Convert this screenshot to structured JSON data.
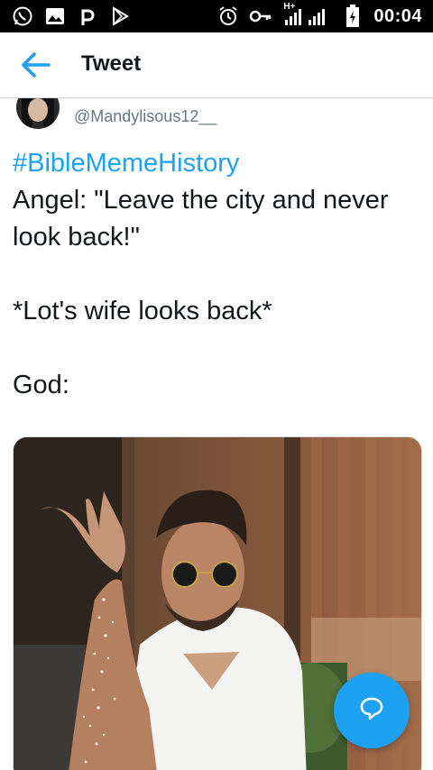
{
  "status_bar": {
    "time": "00:04",
    "network_label": "H+",
    "icons": [
      "whatsapp-icon",
      "gallery-icon",
      "p-icon",
      "play-store-icon",
      "alarm-icon",
      "key-icon",
      "signal-icon",
      "battery-icon"
    ]
  },
  "app_bar": {
    "title": "Tweet",
    "back_icon": "arrow-left-icon",
    "accent_color": "#1da1f2"
  },
  "tweet": {
    "handle": "@Mandylisous12__",
    "hashtag": "#BibleMemeHistory",
    "lines": [
      "Angel: \"Leave the city and never look back!\"",
      "*Lot's wife looks back*",
      "God:"
    ],
    "media_description_icon": "photo"
  },
  "fab": {
    "icon": "reply-bubble-icon"
  }
}
